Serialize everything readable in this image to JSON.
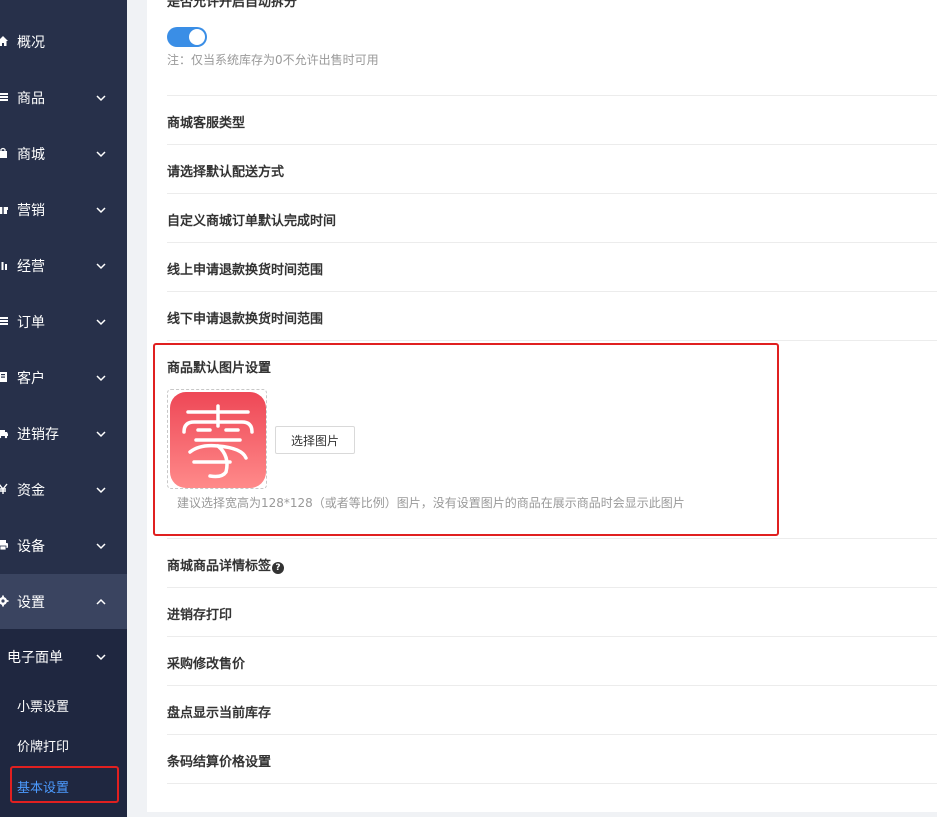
{
  "sidebar": {
    "items": [
      {
        "label": "概况",
        "icon": "home-icon",
        "has_arrow": false
      },
      {
        "label": "商品",
        "icon": "list-icon",
        "has_arrow": true
      },
      {
        "label": "商城",
        "icon": "shopping-bag-icon",
        "has_arrow": true
      },
      {
        "label": "营销",
        "icon": "gift-icon",
        "has_arrow": true
      },
      {
        "label": "经营",
        "icon": "bar-chart-icon",
        "has_arrow": true
      },
      {
        "label": "订单",
        "icon": "list-icon",
        "has_arrow": true
      },
      {
        "label": "客户",
        "icon": "address-book-icon",
        "has_arrow": true
      },
      {
        "label": "进销存",
        "icon": "truck-icon",
        "has_arrow": true
      },
      {
        "label": "资金",
        "icon": "yen-icon",
        "has_arrow": true
      },
      {
        "label": "设备",
        "icon": "print-icon",
        "has_arrow": true
      },
      {
        "label": "设置",
        "icon": "gear-icon",
        "has_arrow": true,
        "expanded": true
      }
    ],
    "submenu_header": "电子面单",
    "sub_items": [
      {
        "label": "小票设置"
      },
      {
        "label": "价牌打印"
      },
      {
        "label": "基本设置",
        "selected": true
      }
    ]
  },
  "content": {
    "top_title": "是否允许开启自动拆分",
    "toggle_on": true,
    "toggle_note": "注：仅当系统库存为0不允许出售时可用",
    "rows_before": [
      "商城客服类型",
      "请选择默认配送方式",
      "自定义商城订单默认完成时间",
      "线上申请退款换货时间范围",
      "线下申请退款换货时间范围"
    ],
    "image_section": {
      "title": "商品默认图片设置",
      "button": "选择图片",
      "hint": "建议选择宽高为128*128（或者等比例）图片，没有设置图片的商品在展示商品时会显示此图片"
    },
    "rows_after": [
      "商城商品详情标签",
      "进销存打印",
      "采购修改售价",
      "盘点显示当前库存",
      "条码结算价格设置"
    ],
    "help_icon_glyph": "?"
  },
  "colors": {
    "sidebar_bg": "#27304a",
    "accent": "#3a8ee6",
    "highlight": "#e02020",
    "selected_text": "#4c9bff"
  }
}
